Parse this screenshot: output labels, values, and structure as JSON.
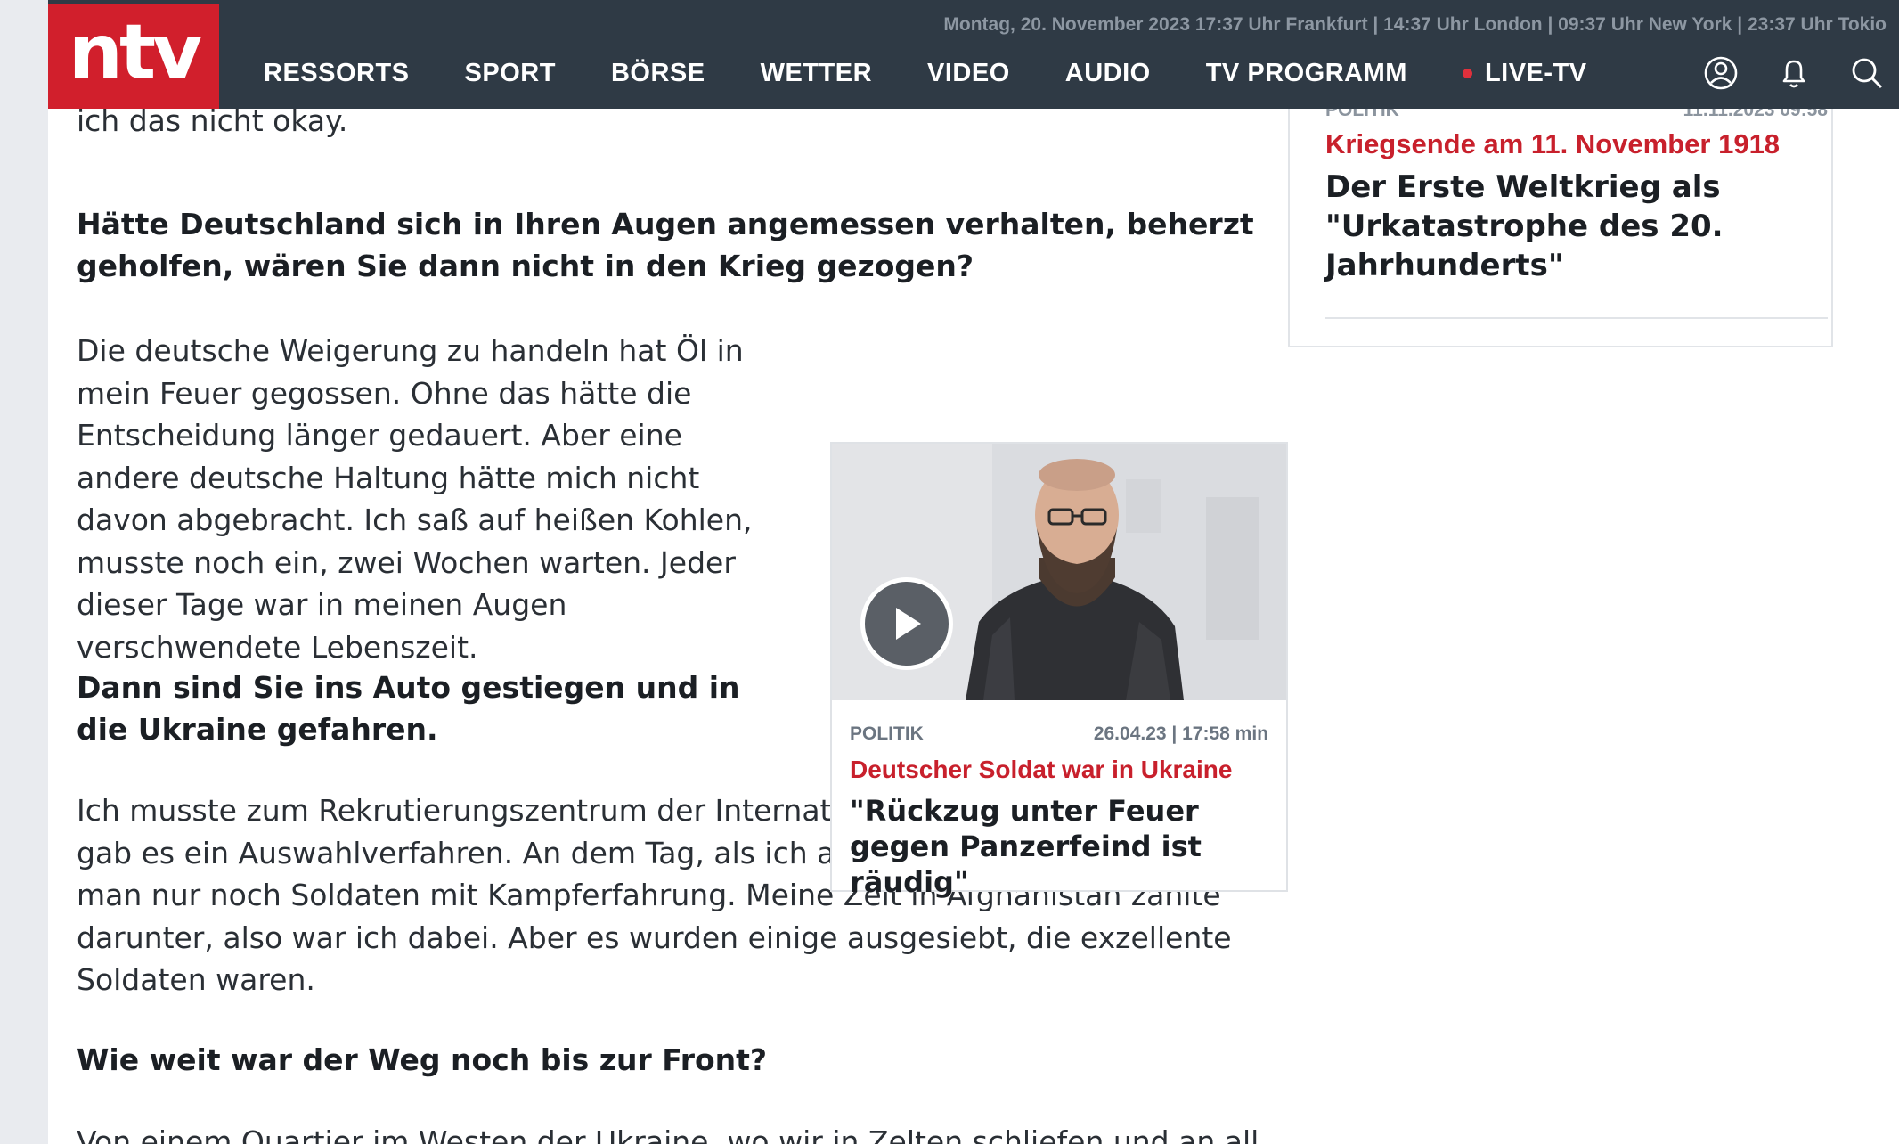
{
  "header": {
    "logo": "ntv",
    "ticker": "Montag, 20. November 2023 17:37 Uhr Frankfurt | 14:37 Uhr London | 09:37 Uhr New York | 23:37 Uhr Tokio",
    "nav": [
      "RESSORTS",
      "SPORT",
      "BÖRSE",
      "WETTER",
      "VIDEO",
      "AUDIO",
      "TV PROGRAMM",
      "LIVE-TV"
    ],
    "icons": [
      "user-icon",
      "bell-icon",
      "search-icon"
    ],
    "brand_color": "#d11f2c",
    "bar_color": "#2f3a45"
  },
  "article": {
    "partial_top": "ich das nicht okay.",
    "q1": "Hätte Deutschland sich in Ihren Augen angemessen verhalten, beherzt geholfen, wären Sie dann nicht in den Krieg gezogen?",
    "a1": "Die deutsche Weigerung zu handeln hat Öl in mein Feuer gegossen. Ohne das hätte die Entscheidung länger gedauert. Aber eine andere deutsche Haltung hätte mich nicht davon abgebracht. Ich saß auf heißen Kohlen, musste noch ein, zwei Wochen warten. Jeder dieser Tage war in meinen Augen verschwendete Lebenszeit.",
    "q2": "Dann sind Sie ins Auto gestiegen und in die Ukraine gefahren.",
    "a2": "Ich musste zum Rekrutierungszentrum der Internationalen Legion in Jaworiw, dort gab es ein Auswahlverfahren. An dem Tag, als ich ankam, hieß es, jetzt nehme man nur noch Soldaten mit Kampferfahrung. Meine Zeit in Afghanistan zählte darunter, also war ich dabei. Aber es wurden einige ausgesiebt, die exzellente Soldaten waren.",
    "q3": "Wie weit war der Weg noch bis zur Front?",
    "partial_bottom": "Von einem Quartier im Westen der Ukraine, wo wir in Zelten schliefen und an all"
  },
  "video_teaser": {
    "section": "POLITIK",
    "date_duration": "26.04.23 | 17:58 min",
    "kicker": "Deutscher Soldat war in Ukraine",
    "title": "\"Rückzug unter Feuer gegen Panzerfeind ist räudig\"",
    "icon": "play-icon"
  },
  "sidebar": {
    "section": "POLITIK",
    "date": "11.11.2023 09:58",
    "kicker": "Kriegsende am 11. November 1918",
    "title": "Der Erste Weltkrieg als \"Urkatastrophe des 20. Jahrhunderts\""
  }
}
